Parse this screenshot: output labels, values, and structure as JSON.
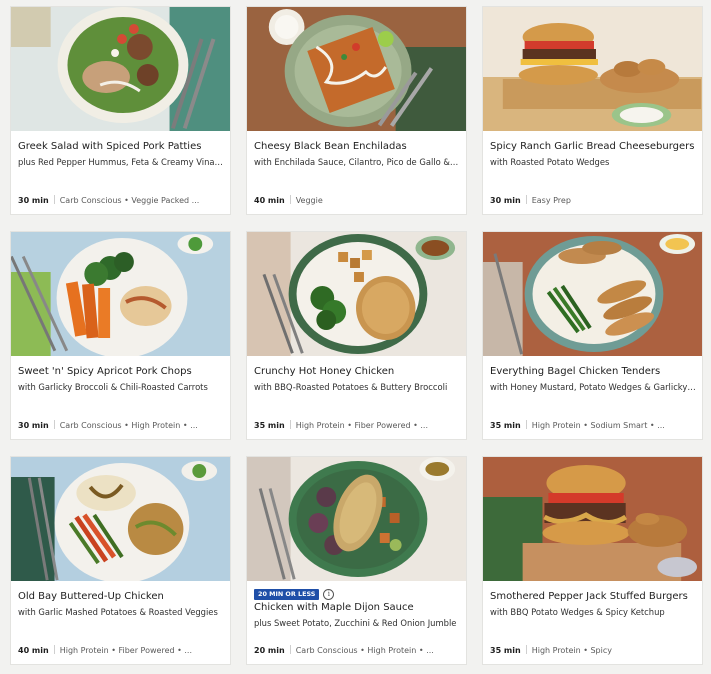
{
  "recipes": [
    {
      "title": "Greek Salad with Spiced Pork Patties",
      "subtitle": "plus Red Pepper Hummus, Feta & Creamy Vinaigrette",
      "time": "30 min",
      "tags": "Carb Conscious • Veggie Packed ..."
    },
    {
      "title": "Cheesy Black Bean Enchiladas",
      "subtitle": "with Enchilada Sauce, Cilantro, Pico de Gallo & Lim...",
      "time": "40 min",
      "tags": "Veggie"
    },
    {
      "title": "Spicy Ranch Garlic Bread Cheeseburgers",
      "subtitle": "with Roasted Potato Wedges",
      "time": "30 min",
      "tags": "Easy Prep"
    },
    {
      "title": "Sweet 'n' Spicy Apricot Pork Chops",
      "subtitle": "with Garlicky Broccoli & Chili-Roasted Carrots",
      "time": "30 min",
      "tags": "Carb Conscious • High Protein • ..."
    },
    {
      "title": "Crunchy Hot Honey Chicken",
      "subtitle": "with BBQ-Roasted Potatoes & Buttery Broccoli",
      "time": "35 min",
      "tags": "High Protein • Fiber Powered • ..."
    },
    {
      "title": "Everything Bagel Chicken Tenders",
      "subtitle": "with Honey Mustard, Potato Wedges & Garlicky Gre...",
      "time": "35 min",
      "tags": "High Protein • Sodium Smart • ..."
    },
    {
      "title": "Old Bay Buttered-Up Chicken",
      "subtitle": "with Garlic Mashed Potatoes & Roasted Veggies",
      "time": "40 min",
      "tags": "High Protein • Fiber Powered • ..."
    },
    {
      "title": "Chicken with Maple Dijon Sauce",
      "subtitle": "plus Sweet Potato, Zucchini & Red Onion Jumble",
      "time": "20 min",
      "tags": "Carb Conscious • High Protein • ...",
      "badge": "20 MIN OR LESS",
      "badge_icon": "info-icon"
    },
    {
      "title": "Smothered Pepper Jack Stuffed Burgers",
      "subtitle": "with BBQ Potato Wedges & Spicy Ketchup",
      "time": "35 min",
      "tags": "High Protein • Spicy"
    }
  ],
  "colors": {
    "badge": "#1f4fa8",
    "page_background": "#f2f2f0"
  }
}
